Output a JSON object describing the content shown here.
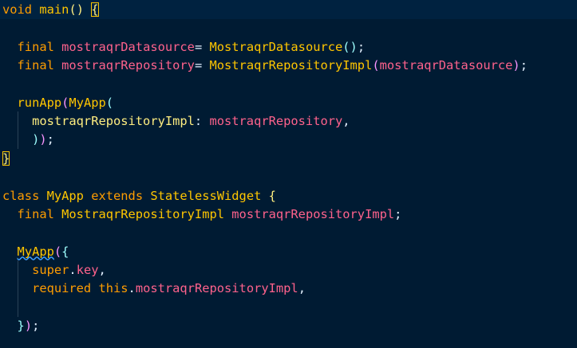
{
  "editor": {
    "lines": [
      [
        {
          "t": "void",
          "c": "tok-kw"
        },
        {
          "t": " ",
          "c": "tok-punc"
        },
        {
          "t": "main",
          "c": "tok-fn"
        },
        {
          "t": "()",
          "c": "tok-paren"
        },
        {
          "t": " ",
          "c": "tok-punc"
        },
        {
          "t": "{",
          "c": "tok-paren bracket-match"
        }
      ],
      [],
      [
        {
          "t": "  final ",
          "c": "tok-kw"
        },
        {
          "t": "mostraqrDatasource",
          "c": "tok-var"
        },
        {
          "t": "= ",
          "c": "tok-punc"
        },
        {
          "t": "MostraqrDatasource",
          "c": "tok-fn"
        },
        {
          "t": "()",
          "c": "tok-paren2"
        },
        {
          "t": ";",
          "c": "tok-punc"
        }
      ],
      [
        {
          "t": "  final ",
          "c": "tok-kw"
        },
        {
          "t": "mostraqrRepository",
          "c": "tok-var"
        },
        {
          "t": "= ",
          "c": "tok-punc"
        },
        {
          "t": "MostraqrRepositoryImpl",
          "c": "tok-fn"
        },
        {
          "t": "(",
          "c": "tok-paren3"
        },
        {
          "t": "mostraqrDatasource",
          "c": "tok-var"
        },
        {
          "t": ")",
          "c": "tok-paren3"
        },
        {
          "t": ";",
          "c": "tok-punc"
        }
      ],
      [],
      [
        {
          "t": "  runApp",
          "c": "tok-fn"
        },
        {
          "t": "(",
          "c": "tok-paren3"
        },
        {
          "t": "MyApp",
          "c": "tok-fn"
        },
        {
          "t": "(",
          "c": "tok-paren2"
        }
      ],
      [
        {
          "t": "    mostraqrRepositoryImpl",
          "c": "tok-cls"
        },
        {
          "t": ": ",
          "c": "tok-punc"
        },
        {
          "t": "mostraqrRepository",
          "c": "tok-var"
        },
        {
          "t": ",",
          "c": "tok-punc"
        }
      ],
      [
        {
          "t": "    ",
          "c": "tok-punc"
        },
        {
          "t": ")",
          "c": "tok-paren2"
        },
        {
          "t": ")",
          "c": "tok-paren3"
        },
        {
          "t": ";",
          "c": "tok-punc"
        }
      ],
      [
        {
          "t": "}",
          "c": "tok-paren bracket-match"
        }
      ],
      [],
      [
        {
          "t": "class ",
          "c": "tok-kw"
        },
        {
          "t": "MyApp",
          "c": "tok-fn"
        },
        {
          "t": " extends ",
          "c": "tok-kw"
        },
        {
          "t": "StatelessWidget",
          "c": "tok-fn"
        },
        {
          "t": " {",
          "c": "tok-paren"
        }
      ],
      [
        {
          "t": "  final ",
          "c": "tok-kw"
        },
        {
          "t": "MostraqrRepositoryImpl",
          "c": "tok-fn"
        },
        {
          "t": " ",
          "c": "tok-punc"
        },
        {
          "t": "mostraqrRepositoryImpl",
          "c": "tok-var"
        },
        {
          "t": ";",
          "c": "tok-punc"
        }
      ],
      [],
      [
        {
          "t": "  ",
          "c": "tok-punc"
        },
        {
          "t": "MyApp",
          "c": "tok-fn squiggle"
        },
        {
          "t": "(",
          "c": "tok-paren3"
        },
        {
          "t": "{",
          "c": "tok-paren2"
        }
      ],
      [
        {
          "t": "    super",
          "c": "tok-kw"
        },
        {
          "t": ".",
          "c": "tok-punc"
        },
        {
          "t": "key",
          "c": "tok-var"
        },
        {
          "t": ",",
          "c": "tok-punc"
        }
      ],
      [
        {
          "t": "    required ",
          "c": "tok-kw"
        },
        {
          "t": "this",
          "c": "tok-kw"
        },
        {
          "t": ".",
          "c": "tok-punc"
        },
        {
          "t": "mostraqrRepositoryImpl",
          "c": "tok-var"
        },
        {
          "t": ",",
          "c": "tok-punc"
        }
      ],
      [],
      [
        {
          "t": "  ",
          "c": "tok-punc"
        },
        {
          "t": "}",
          "c": "tok-paren2"
        },
        {
          "t": ")",
          "c": "tok-paren3"
        },
        {
          "t": ";",
          "c": "tok-punc"
        }
      ]
    ]
  },
  "colors": {
    "background": "#001b33",
    "keyword": "#ff9d00",
    "function": "#ffc600",
    "variable": "#ff628c",
    "named_param": "#ffee80"
  }
}
